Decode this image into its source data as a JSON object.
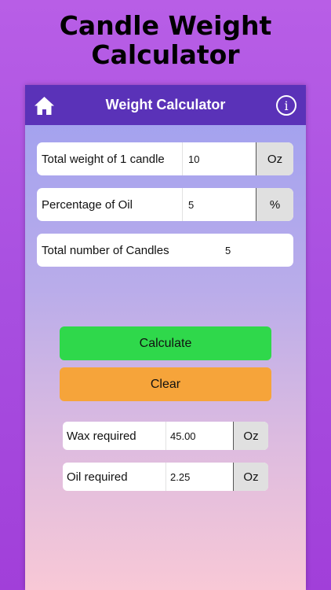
{
  "promo": {
    "title_line1": "Candle Weight",
    "title_line2": "Calculator"
  },
  "navbar": {
    "title": "Weight Calculator",
    "home_icon": "home-icon",
    "info_icon": "info-icon",
    "info_glyph": "i",
    "color": "#5a32b8"
  },
  "inputs": {
    "weight": {
      "label": "Total weight of 1 candle",
      "value": "10",
      "unit": "Oz"
    },
    "oil_pct": {
      "label": "Percentage of Oil",
      "value": "5",
      "unit": "%"
    },
    "count": {
      "label": "Total number of Candles",
      "value": "5"
    }
  },
  "buttons": {
    "calculate": "Calculate",
    "clear": "Clear",
    "calculate_color": "#2fd84b",
    "clear_color": "#f6a43a"
  },
  "results": {
    "wax": {
      "label": "Wax required",
      "value": "45.00",
      "unit": "Oz"
    },
    "oil": {
      "label": "Oil required",
      "value": "2.25",
      "unit": "Oz"
    }
  }
}
